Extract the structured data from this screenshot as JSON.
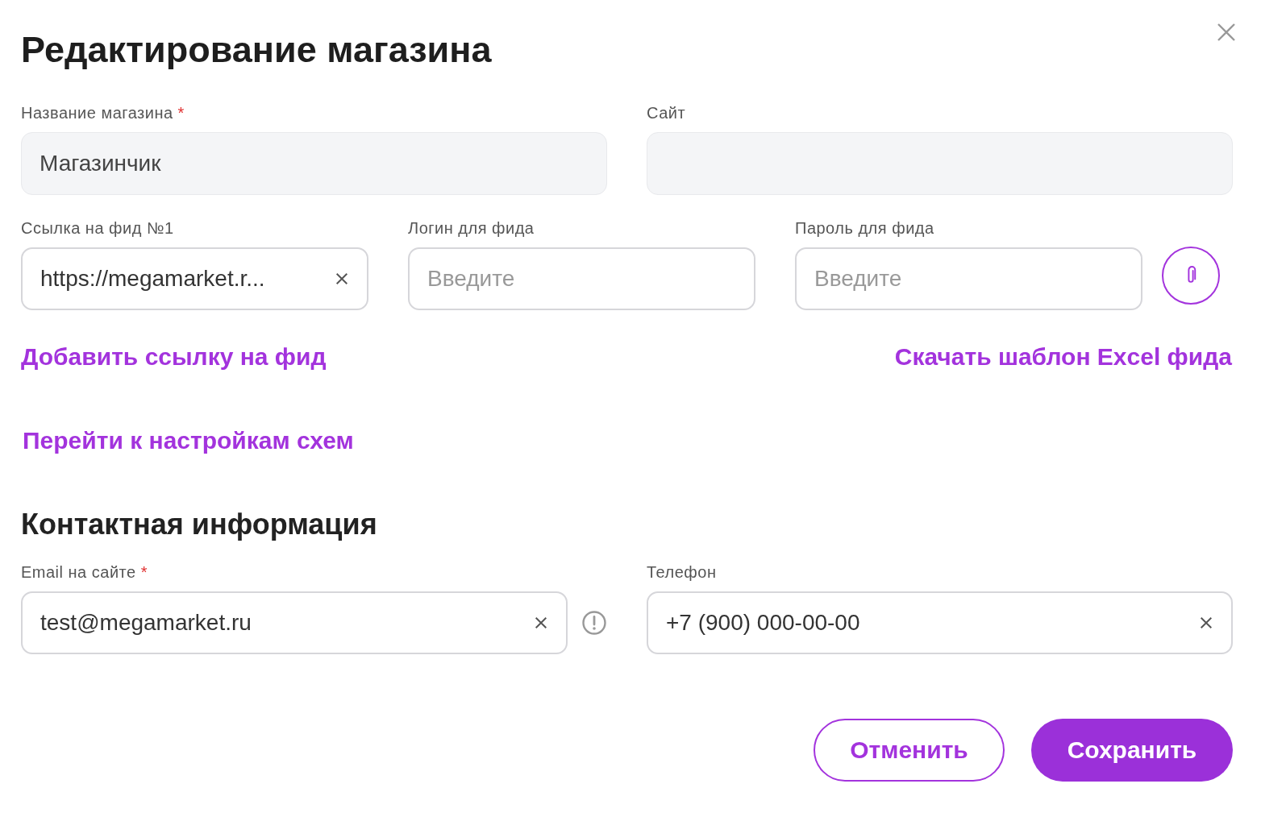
{
  "title": "Редактирование магазина",
  "main_fields": [
    {
      "label": "Название магазина",
      "mark": "*",
      "kind": "filled",
      "value": "Магазинчик"
    },
    {
      "label": "Сайт",
      "kind": "filled"
    }
  ],
  "feed_fields": [
    {
      "label": "Ссылка на фид №1",
      "kind": "outlined",
      "value": "https://megamarket.r...",
      "clearable": true
    },
    {
      "label": "Логин для фида",
      "kind": "outlined",
      "placeholder": "Введите",
      "clearable": false
    },
    {
      "label": "Пароль для фида",
      "kind": "outlined",
      "placeholder": "Введите",
      "clearable": false
    }
  ],
  "links": {
    "add_feed": "Добавить ссылку на фид",
    "download_template": "Скачать шаблон Excel фида",
    "schemes": "Перейти к настройкам схем"
  },
  "contact_title": "Контактная информация",
  "contact_fields": [
    {
      "label": "Email на сайте",
      "mark": "*",
      "kind": "outlined",
      "value": "test@megamarket.ru",
      "clearable": true,
      "warning": true
    },
    {
      "label": "Телефон",
      "kind": "outlined",
      "value": "+7 (900) 000-00-00",
      "clearable": true,
      "warning": false
    }
  ],
  "buttons": [
    {
      "label": "Отменить",
      "kind": "secondary"
    },
    {
      "label": "Сохранить",
      "kind": "primary"
    }
  ]
}
